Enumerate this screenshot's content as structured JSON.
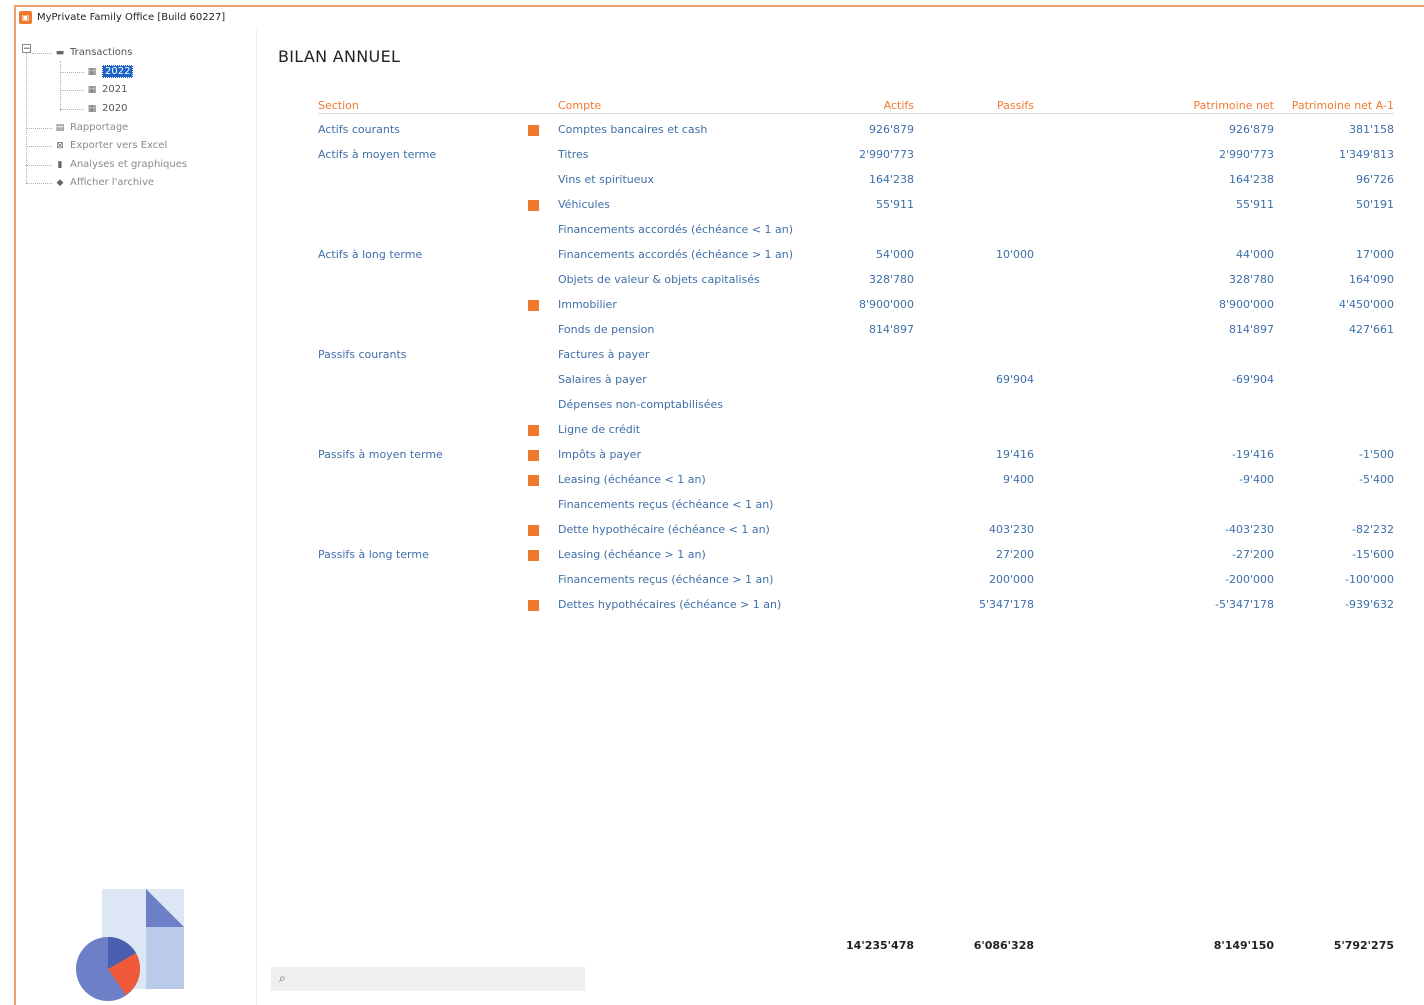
{
  "window": {
    "title": "MyPrivate Family Office [Build 60227]"
  },
  "sidebar": {
    "transactions_label": "Transactions",
    "years": [
      {
        "label": "2022",
        "selected": true
      },
      {
        "label": "2021",
        "selected": false
      },
      {
        "label": "2020",
        "selected": false
      }
    ],
    "items": [
      {
        "label": "Rapportage",
        "icon": "report-icon"
      },
      {
        "label": "Exporter vers Excel",
        "icon": "excel-icon"
      },
      {
        "label": "Analyses et graphiques",
        "icon": "bar-chart-icon"
      },
      {
        "label": "Afficher l'archive",
        "icon": "archive-icon"
      }
    ]
  },
  "report": {
    "title": "BILAN ANNUEL",
    "headers": {
      "section": "Section",
      "account": "Compte",
      "assets": "Actifs",
      "liabilities": "Passifs",
      "net": "Patrimoine net",
      "net_prev": "Patrimoine net A-1"
    },
    "rows": [
      {
        "section": "Actifs courants",
        "marker": true,
        "account": "Comptes bancaires et cash",
        "assets": "926'879",
        "liabilities": "",
        "net": "926'879",
        "net_prev": "381'158"
      },
      {
        "section": "Actifs à moyen terme",
        "marker": false,
        "account": "Titres",
        "assets": "2'990'773",
        "liabilities": "",
        "net": "2'990'773",
        "net_prev": "1'349'813"
      },
      {
        "section": "",
        "marker": false,
        "account": "Vins et spiritueux",
        "assets": "164'238",
        "liabilities": "",
        "net": "164'238",
        "net_prev": "96'726"
      },
      {
        "section": "",
        "marker": true,
        "account": "Véhicules",
        "assets": "55'911",
        "liabilities": "",
        "net": "55'911",
        "net_prev": "50'191"
      },
      {
        "section": "",
        "marker": false,
        "account": "Financements accordés (échéance < 1 an)",
        "assets": "",
        "liabilities": "",
        "net": "",
        "net_prev": ""
      },
      {
        "section": "Actifs à long terme",
        "marker": false,
        "account": "Financements accordés (échéance > 1 an)",
        "assets": "54'000",
        "liabilities": "10'000",
        "net": "44'000",
        "net_prev": "17'000"
      },
      {
        "section": "",
        "marker": false,
        "account": "Objets de valeur & objets capitalisés",
        "assets": "328'780",
        "liabilities": "",
        "net": "328'780",
        "net_prev": "164'090"
      },
      {
        "section": "",
        "marker": true,
        "account": "Immobilier",
        "assets": "8'900'000",
        "liabilities": "",
        "net": "8'900'000",
        "net_prev": "4'450'000"
      },
      {
        "section": "",
        "marker": false,
        "account": "Fonds de pension",
        "assets": "814'897",
        "liabilities": "",
        "net": "814'897",
        "net_prev": "427'661"
      },
      {
        "section": "Passifs courants",
        "marker": false,
        "account": "Factures à payer",
        "assets": "",
        "liabilities": "",
        "net": "",
        "net_prev": ""
      },
      {
        "section": "",
        "marker": false,
        "account": "Salaires à payer",
        "assets": "",
        "liabilities": "69'904",
        "net": "-69'904",
        "net_prev": ""
      },
      {
        "section": "",
        "marker": false,
        "account": "Dépenses non-comptabilisées",
        "assets": "",
        "liabilities": "",
        "net": "",
        "net_prev": ""
      },
      {
        "section": "",
        "marker": true,
        "account": "Ligne de crédit",
        "assets": "",
        "liabilities": "",
        "net": "",
        "net_prev": ""
      },
      {
        "section": "Passifs à moyen terme",
        "marker": true,
        "account": "Impôts à payer",
        "assets": "",
        "liabilities": "19'416",
        "net": "-19'416",
        "net_prev": "-1'500"
      },
      {
        "section": "",
        "marker": true,
        "account": "Leasing (échéance < 1 an)",
        "assets": "",
        "liabilities": "9'400",
        "net": "-9'400",
        "net_prev": "-5'400"
      },
      {
        "section": "",
        "marker": false,
        "account": "Financements reçus (échéance < 1 an)",
        "assets": "",
        "liabilities": "",
        "net": "",
        "net_prev": ""
      },
      {
        "section": "",
        "marker": true,
        "account": "Dette hypothécaire (échéance < 1 an)",
        "assets": "",
        "liabilities": "403'230",
        "net": "-403'230",
        "net_prev": "-82'232"
      },
      {
        "section": "Passifs à long terme",
        "marker": true,
        "account": "Leasing (échéance > 1 an)",
        "assets": "",
        "liabilities": "27'200",
        "net": "-27'200",
        "net_prev": "-15'600"
      },
      {
        "section": "",
        "marker": false,
        "account": "Financements reçus (échéance > 1 an)",
        "assets": "",
        "liabilities": "200'000",
        "net": "-200'000",
        "net_prev": "-100'000"
      },
      {
        "section": "",
        "marker": true,
        "account": "Dettes hypothécaires (échéance > 1 an)",
        "assets": "",
        "liabilities": "5'347'178",
        "net": "-5'347'178",
        "net_prev": "-939'632"
      }
    ],
    "totals": {
      "assets": "14'235'478",
      "liabilities": "6'086'328",
      "net": "8'149'150",
      "net_prev": "5'792'275"
    }
  },
  "colors": {
    "accent": "#ef7a2f",
    "link": "#3f6fa8",
    "selection": "#1e64c8"
  }
}
